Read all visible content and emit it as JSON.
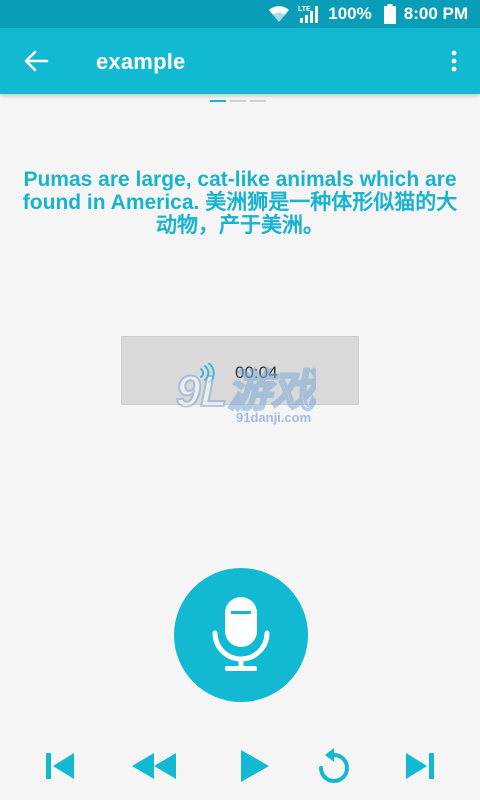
{
  "status_bar": {
    "network_label": "LTE",
    "battery": "100%",
    "time": "8:00 PM",
    "icons": [
      "wifi-icon",
      "signal-icon",
      "battery-icon"
    ]
  },
  "toolbar": {
    "title": "example",
    "back_icon": "arrow-left-icon",
    "menu_icon": "more-vert-icon"
  },
  "pager": {
    "pages": 3,
    "current": 1
  },
  "content": {
    "sentence": "Pumas are large, cat-like animals which are found in America.  美洲狮是一种体形似猫的大动物，产于美洲。"
  },
  "audio": {
    "duration": "00:04",
    "icon": "sound-waves-icon"
  },
  "watermark": {
    "logo_text": "9L游戏",
    "site": "91danji.com"
  },
  "record": {
    "icon": "microphone-icon"
  },
  "playback_controls": [
    {
      "name": "skip-previous-icon"
    },
    {
      "name": "rewind-icon"
    },
    {
      "name": "play-icon"
    },
    {
      "name": "replay-icon"
    },
    {
      "name": "skip-next-icon"
    }
  ],
  "colors": {
    "status_bar": "#0a9db8",
    "primary": "#12b9d3",
    "text_accent": "#19b3cf",
    "background": "#f5f5f5",
    "audio_box": "#d9d9d9"
  }
}
